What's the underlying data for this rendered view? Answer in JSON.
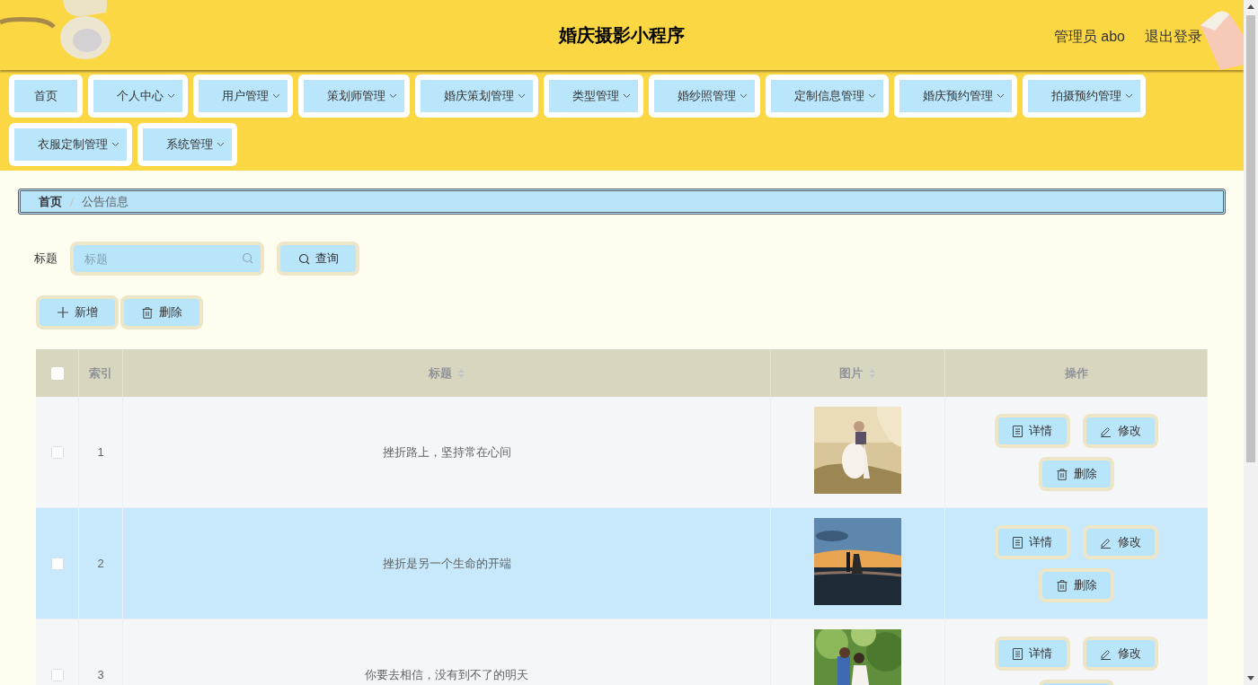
{
  "header": {
    "title": "婚庆摄影小程序",
    "user": "管理员 abo",
    "logout": "退出登录"
  },
  "nav": [
    {
      "label": "首页",
      "dropdown": false
    },
    {
      "label": "个人中心",
      "dropdown": true
    },
    {
      "label": "用户管理",
      "dropdown": true
    },
    {
      "label": "策划师管理",
      "dropdown": true
    },
    {
      "label": "婚庆策划管理",
      "dropdown": true
    },
    {
      "label": "类型管理",
      "dropdown": true
    },
    {
      "label": "婚纱照管理",
      "dropdown": true
    },
    {
      "label": "定制信息管理",
      "dropdown": true
    },
    {
      "label": "婚庆预约管理",
      "dropdown": true
    },
    {
      "label": "拍摄预约管理",
      "dropdown": true
    },
    {
      "label": "衣服定制管理",
      "dropdown": true
    },
    {
      "label": "系统管理",
      "dropdown": true
    }
  ],
  "breadcrumb": [
    {
      "label": "首页",
      "current": false
    },
    {
      "label": "公告信息",
      "current": true
    }
  ],
  "search": {
    "label": "标题",
    "placeholder": "标题",
    "button": "查询"
  },
  "toolbar": [
    {
      "kind": "add",
      "label": "新增"
    },
    {
      "kind": "delete",
      "label": "删除"
    }
  ],
  "table": {
    "select_all": {
      "checked": false
    },
    "columns": [
      {
        "label": "索引",
        "sortable": false
      },
      {
        "label": "标题",
        "sortable": true
      },
      {
        "label": "图片",
        "sortable": true
      },
      {
        "label": "操作",
        "sortable": false
      }
    ],
    "rows": [
      {
        "checked": false,
        "selected": false,
        "index": "1",
        "title": "挫折路上，坚持常在心间",
        "image": {
          "kind": "picture"
        },
        "actions": [
          {
            "kind": "detail",
            "label": "详情"
          },
          {
            "kind": "edit",
            "label": "修改"
          },
          {
            "kind": "delete",
            "label": "删除"
          }
        ]
      },
      {
        "checked": false,
        "selected": true,
        "index": "2",
        "title": "挫折是另一个生命的开端",
        "image": {
          "kind": "picture"
        },
        "actions": [
          {
            "kind": "detail",
            "label": "详情"
          },
          {
            "kind": "edit",
            "label": "修改"
          },
          {
            "kind": "delete",
            "label": "删除"
          }
        ]
      },
      {
        "checked": false,
        "selected": false,
        "index": "3",
        "title": "你要去相信，没有到不了的明天",
        "image": {
          "kind": "picture"
        },
        "actions": [
          {
            "kind": "detail",
            "label": "详情"
          },
          {
            "kind": "edit",
            "label": "修改"
          },
          {
            "kind": "delete"
          }
        ]
      }
    ]
  }
}
